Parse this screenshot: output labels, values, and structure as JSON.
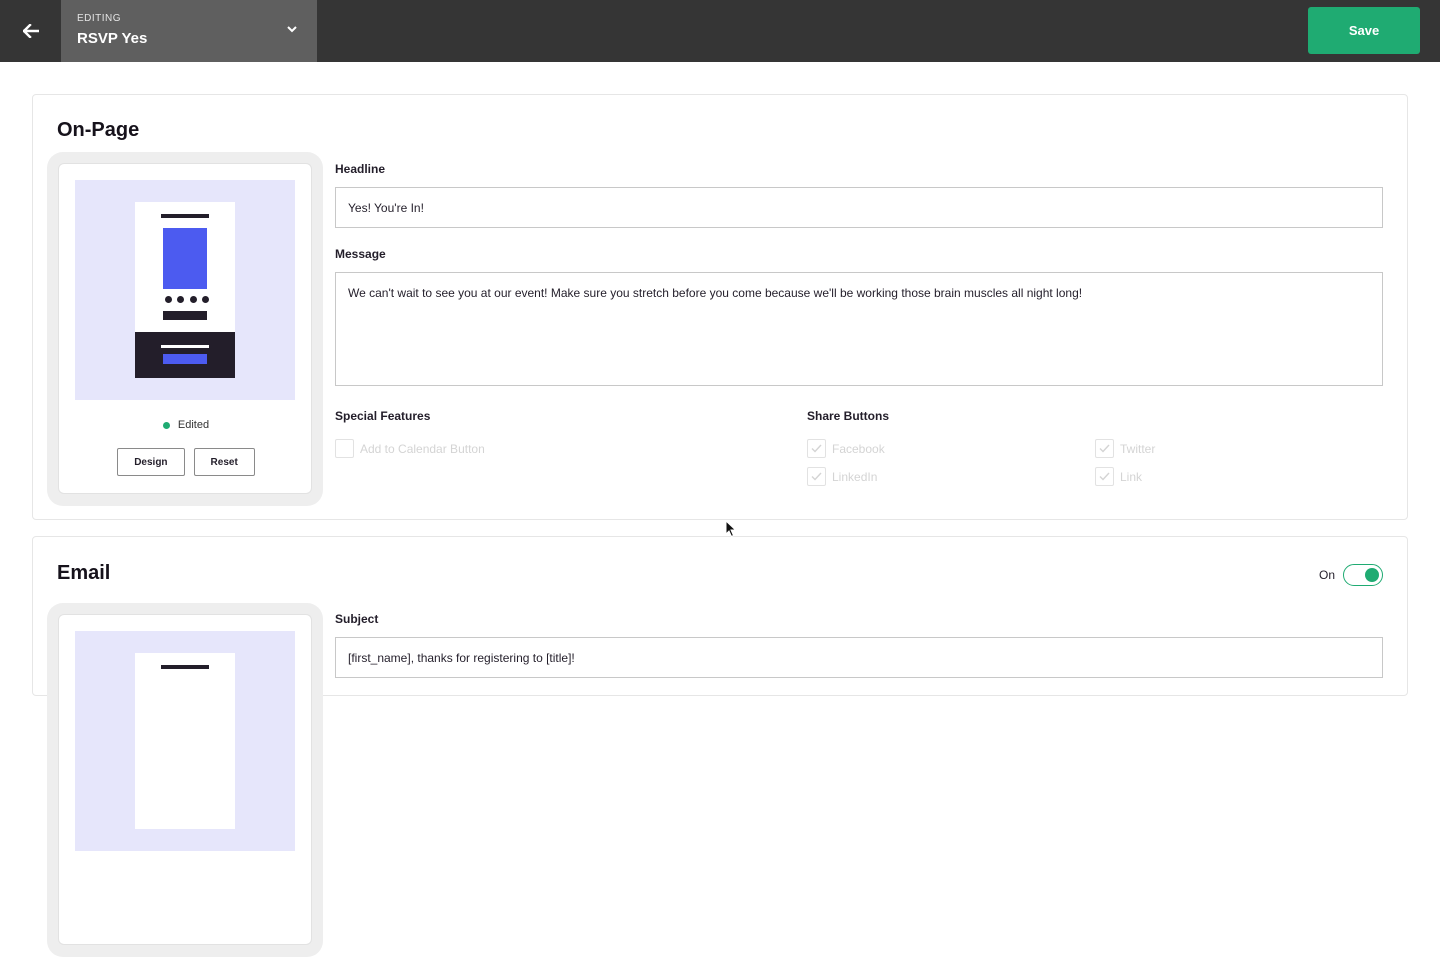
{
  "topbar": {
    "back_icon": "arrow-left-icon",
    "editing_label": "EDITING",
    "editing_name": "RSVP Yes",
    "dropdown_icon": "chevron-down-icon",
    "save_label": "Save"
  },
  "colors": {
    "topbar": "#353535",
    "editing_box": "#5f5f5f",
    "accent_green": "#1fab72",
    "preview_bg": "#e6e6fb",
    "preview_blue": "#4c5bf0",
    "dark": "#231e2a"
  },
  "onpage": {
    "title": "On-Page",
    "status": "Edited",
    "design_label": "Design",
    "reset_label": "Reset",
    "headline_label": "Headline",
    "headline_value": "Yes! You're In!",
    "message_label": "Message",
    "message_value": "We can't wait to see you at our event! Make sure you stretch before you come because we'll be working those brain muscles all night long!",
    "special_features_label": "Special Features",
    "add_to_calendar_label": "Add to Calendar Button",
    "add_to_calendar_checked": false,
    "share_buttons_label": "Share Buttons",
    "share": {
      "facebook": {
        "label": "Facebook",
        "checked": true
      },
      "twitter": {
        "label": "Twitter",
        "checked": true
      },
      "linkedin": {
        "label": "LinkedIn",
        "checked": true
      },
      "link": {
        "label": "Link",
        "checked": true
      }
    }
  },
  "email": {
    "title": "Email",
    "toggle_label": "On",
    "toggle_on": true,
    "subject_label": "Subject",
    "subject_value": "[first_name], thanks for registering to [title]!"
  }
}
